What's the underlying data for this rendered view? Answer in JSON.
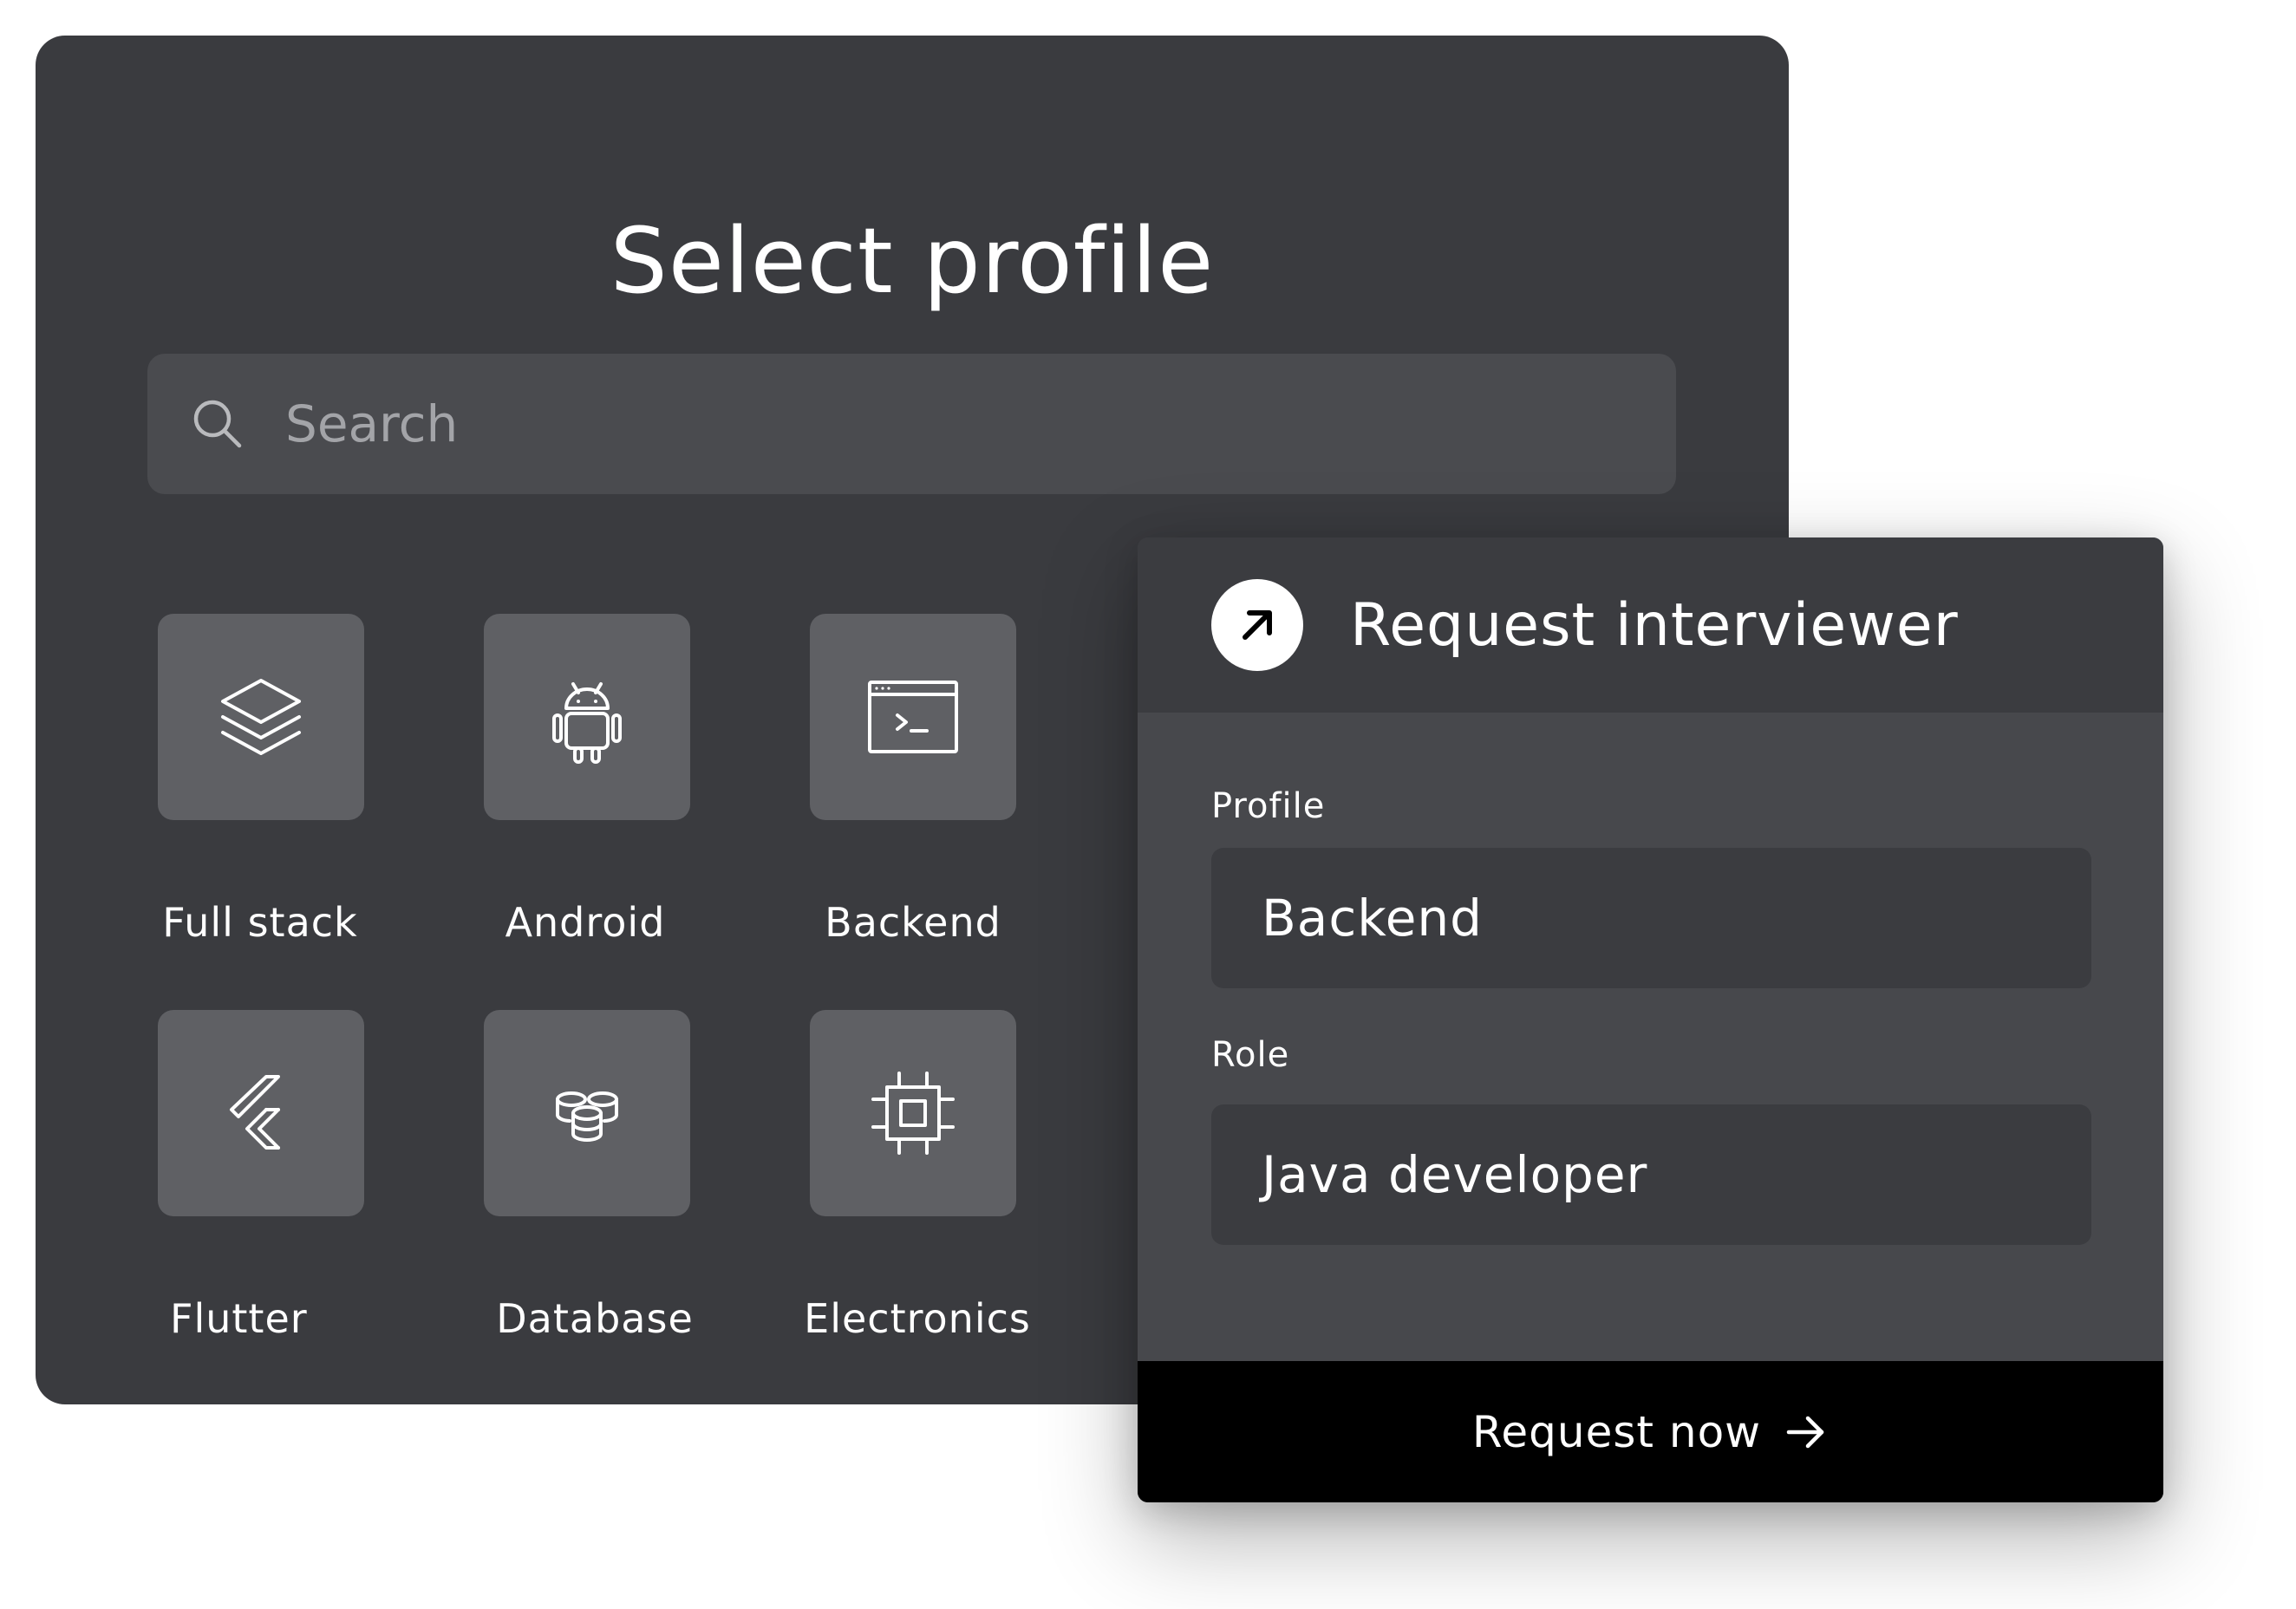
{
  "select_profile": {
    "title": "Select profile",
    "search_placeholder": "Search",
    "profiles": [
      {
        "label": "Full stack",
        "icon": "layers-icon"
      },
      {
        "label": "Android",
        "icon": "android-icon"
      },
      {
        "label": "Backend",
        "icon": "terminal-window-icon"
      },
      {
        "label": "Flutter",
        "icon": "flutter-icon"
      },
      {
        "label": "Database",
        "icon": "database-icon"
      },
      {
        "label": "Electronics",
        "icon": "chip-icon"
      }
    ]
  },
  "request_interviewer": {
    "title": "Request interviewer",
    "badge_icon": "arrow-up-right-icon",
    "profile_label": "Profile",
    "profile_value": "Backend",
    "role_label": "Role",
    "role_value": "Java developer",
    "button_label": "Request now",
    "button_icon": "arrow-right-icon"
  },
  "colors": {
    "panel_bg": "#3a3b3f",
    "search_bg": "#4a4b4f",
    "tile_bg": "#5f6064",
    "card_bg": "#47484c",
    "card_header_bg": "#3b3c40",
    "button_bg": "#000000",
    "text": "#ffffff",
    "placeholder": "#a3a4a8"
  }
}
